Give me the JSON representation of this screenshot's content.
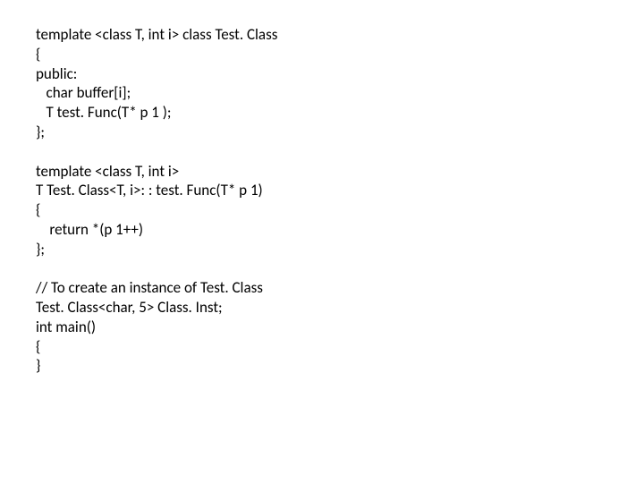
{
  "code": {
    "block1": "template <class T, int i> class Test. Class\n{\npublic:\n   char buffer[i];\n   T test. Func(T* p 1 );\n};",
    "block2": "template <class T, int i>\nT Test. Class<T, i>: : test. Func(T* p 1)\n{\n    return *(p 1++)\n};",
    "block3": "// To create an instance of Test. Class\nTest. Class<char, 5> Class. Inst;\nint main()\n{\n}"
  }
}
